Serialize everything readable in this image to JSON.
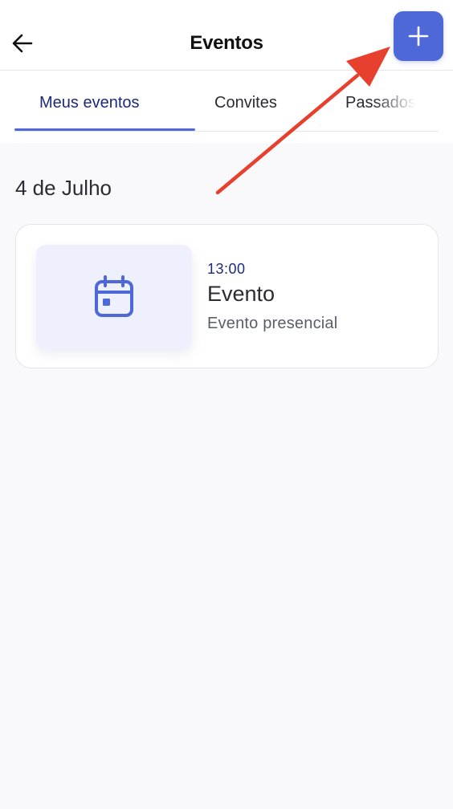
{
  "header": {
    "title": "Eventos",
    "back_icon": "arrow-left-icon",
    "add_icon": "plus-icon"
  },
  "tabs": [
    {
      "label": "Meus eventos",
      "active": true
    },
    {
      "label": "Convites",
      "active": false
    },
    {
      "label": "Passados",
      "active": false
    }
  ],
  "sections": [
    {
      "date": "4 de Julho",
      "events": [
        {
          "time": "13:00",
          "title": "Evento",
          "subtitle": "Evento presencial",
          "icon": "calendar-icon"
        }
      ]
    }
  ],
  "annotation": {
    "icon": "red-arrow-icon"
  },
  "colors": {
    "accent": "#4f68d8",
    "tab_active_text": "#1c2a7a",
    "annotation": "#e8402f",
    "background": "#f9f9fc",
    "thumb_background": "#eef0fd"
  }
}
